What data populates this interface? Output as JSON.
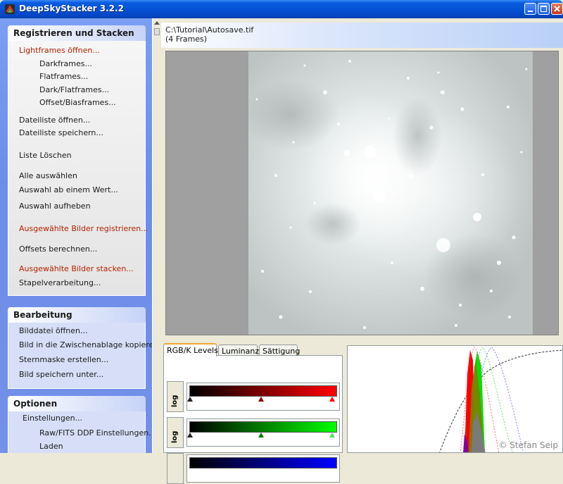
{
  "window": {
    "title": "DeepSkyStacker 3.2.2"
  },
  "sidebar": {
    "registration": {
      "header": "Registrieren und Stacken",
      "items": [
        "Lightframes öffnen...",
        "Darkframes...",
        "Flatframes...",
        "Dark/Flatframes...",
        "Offset/Biasframes...",
        "Dateiliste öffnen...",
        "Dateiliste speichern...",
        "Liste Löschen",
        "Alle auswählen",
        "Auswahl ab einem Wert...",
        "Auswahl aufheben",
        "Ausgewählte Bilder registrieren...",
        "Offsets berechnen...",
        "Ausgewählte Bilder stacken...",
        "Stapelverarbeitung..."
      ]
    },
    "editing": {
      "header": "Bearbeitung",
      "items": [
        "Bilddatei öffnen...",
        "Bild in die Zwischenablage kopieren",
        "Sternmaske erstellen...",
        "Bild speichern unter..."
      ]
    },
    "options": {
      "header": "Optionen",
      "items": [
        "Einstellungen...",
        "Raw/FITS DDP Einstellungen...",
        "Laden"
      ]
    }
  },
  "main": {
    "file_path": "C:\\Tutorial\\Autosave.tif",
    "frame_count": "(4 Frames)",
    "tabs": [
      "RGB/K Levels",
      "Luminanz",
      "Sättigung"
    ],
    "levels": {
      "log_label": "log",
      "channels": [
        {
          "name": "red",
          "color": "#ff0000"
        },
        {
          "name": "green",
          "color": "#00ff00"
        },
        {
          "name": "blue",
          "color": "#0000ff"
        }
      ]
    },
    "copyright": "© Stefan Seip"
  },
  "colors": {
    "titlebar": "#0553d6",
    "sidebar": "#7391ea",
    "accent_red_text": "#b22100",
    "tab_highlight": "#f0a530"
  }
}
